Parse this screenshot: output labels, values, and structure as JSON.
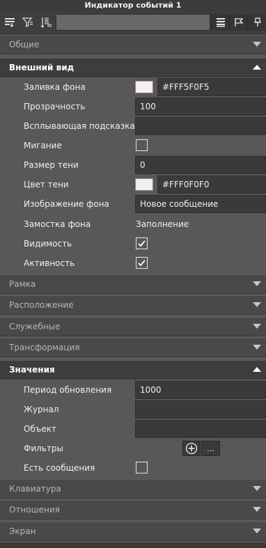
{
  "window": {
    "title": "Индикатор событий 1"
  },
  "toolbar": {
    "icons": [
      "sort-down-icon",
      "filter-icon",
      "tree-sort-icon",
      "list-view-icon",
      "flag-icon",
      "pin-icon"
    ],
    "search_value": ""
  },
  "sections": {
    "general": "Общие",
    "appearance": "Внешний вид",
    "frame": "Рамка",
    "layout": "Расположение",
    "service": "Служебные",
    "transform": "Трансформация",
    "values": "Значения",
    "keyboard": "Клавиатура",
    "relations": "Отношения",
    "screen": "Экран"
  },
  "appearance": {
    "bg_fill_label": "Заливка фона",
    "bg_fill_value": "#FFF5F0F5",
    "bg_fill_color": "#F5F0F5",
    "opacity_label": "Прозрачность",
    "opacity_value": "100",
    "tooltip_label": "Всплывающая подсказка",
    "tooltip_value": "",
    "blink_label": "Мигание",
    "blink_checked": false,
    "shadow_size_label": "Размер тени",
    "shadow_size_value": "0",
    "shadow_color_label": "Цвет тени",
    "shadow_color_value": "#FFF0F0F0",
    "shadow_color_color": "#F0F0F0",
    "bg_image_label": "Изображение фона",
    "bg_image_value": "Новое сообщение",
    "bg_tile_label": "Замостка фона",
    "bg_tile_value": "Заполнение",
    "visible_label": "Видимость",
    "visible_checked": true,
    "active_label": "Активность",
    "active_checked": true
  },
  "values": {
    "refresh_label": "Период обновления",
    "refresh_value": "1000",
    "journal_label": "Журнал",
    "journal_value": "",
    "object_label": "Объект",
    "object_value": "",
    "filters_label": "Фильтры",
    "filters_more": "...",
    "has_messages_label": "Есть сообщения",
    "has_messages_checked": false
  }
}
